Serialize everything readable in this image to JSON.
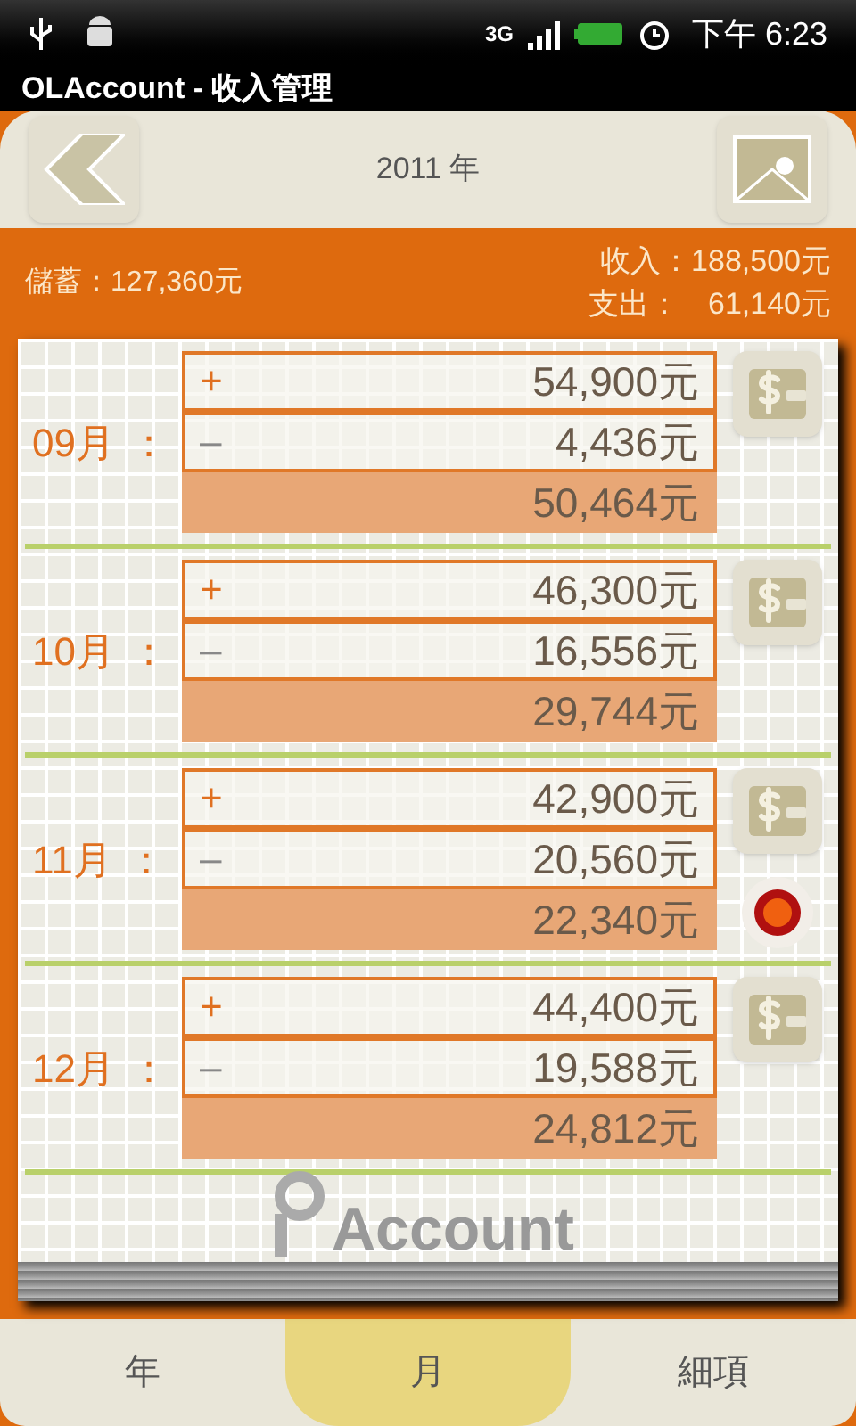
{
  "status_bar": {
    "network": "3G",
    "time": "下午 6:23"
  },
  "window": {
    "title": "OLAccount - 收入管理"
  },
  "header": {
    "year": "2011 年"
  },
  "summary": {
    "savings": "儲蓄：127,360元",
    "income": "收入：188,500元",
    "expense_label": "支出：",
    "expense": "61,140元"
  },
  "months": [
    {
      "label": "09月",
      "separator": "：",
      "rows": [
        {
          "kind": "income",
          "sign": "+",
          "amount": "54,900元"
        },
        {
          "kind": "expense",
          "sign": "–",
          "amount": "4,436元"
        },
        {
          "kind": "total",
          "amount": "50,464元"
        }
      ],
      "alert": false
    },
    {
      "label": "10月",
      "separator": "：",
      "rows": [
        {
          "kind": "income",
          "sign": "+",
          "amount": "46,300元"
        },
        {
          "kind": "expense",
          "sign": "–",
          "amount": "16,556元"
        },
        {
          "kind": "total",
          "amount": "29,744元"
        }
      ],
      "alert": false
    },
    {
      "label": "11月",
      "separator": "：",
      "rows": [
        {
          "kind": "income",
          "sign": "+",
          "amount": "42,900元"
        },
        {
          "kind": "expense",
          "sign": "–",
          "amount": "20,560元"
        },
        {
          "kind": "total",
          "amount": "22,340元"
        }
      ],
      "alert": true
    },
    {
      "label": "12月",
      "separator": "：",
      "rows": [
        {
          "kind": "income",
          "sign": "+",
          "amount": "44,400元"
        },
        {
          "kind": "expense",
          "sign": "–",
          "amount": "19,588元"
        },
        {
          "kind": "total",
          "amount": "24,812元"
        }
      ],
      "alert": false
    }
  ],
  "logo": "Account",
  "tabs": [
    {
      "label": "年",
      "selected": false
    },
    {
      "label": "月",
      "selected": true
    },
    {
      "label": "細項",
      "selected": false
    }
  ]
}
